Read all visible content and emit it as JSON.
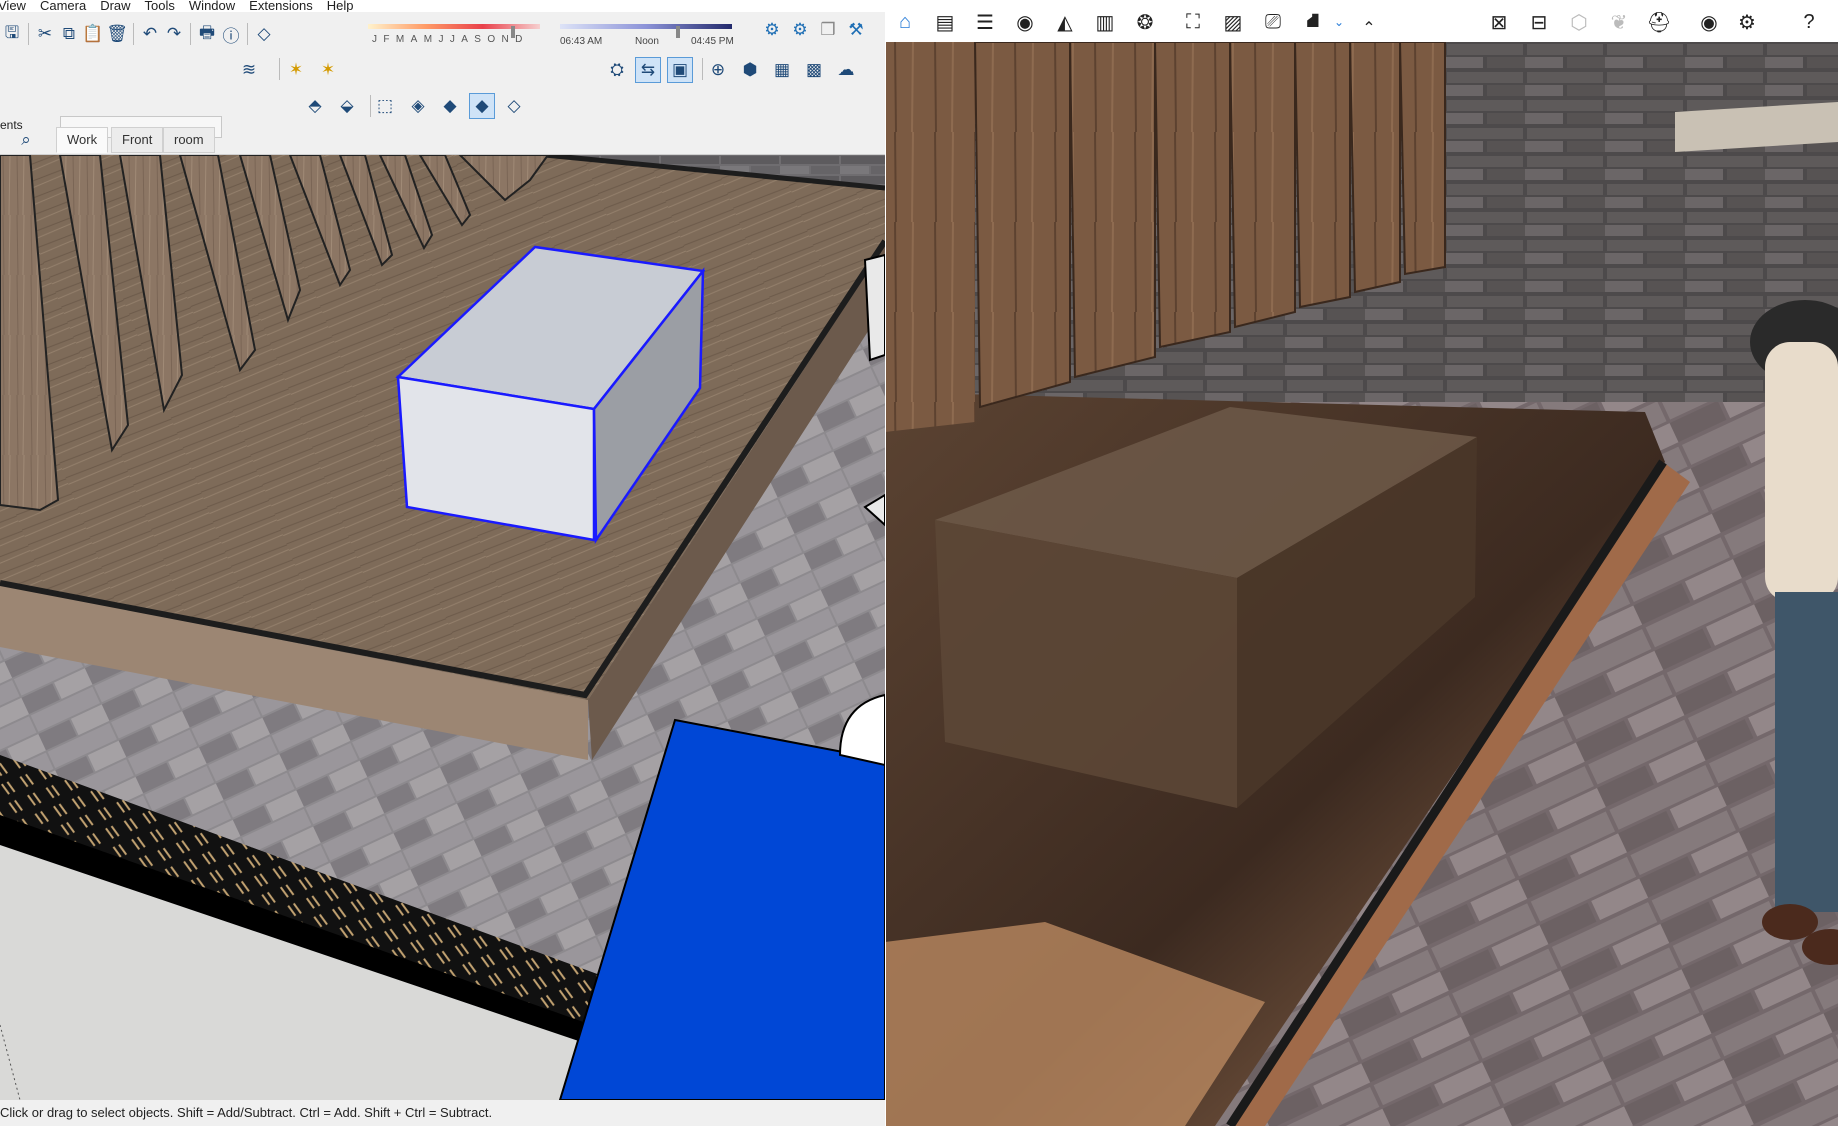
{
  "menu": [
    "View",
    "Camera",
    "Draw",
    "Tools",
    "Window",
    "Extensions",
    "Help"
  ],
  "shadow": {
    "months": "JFMAMJJASOND",
    "sunrise": "06:43 AM",
    "noon": "Noon",
    "sunset": "04:45 PM"
  },
  "layer": {
    "label": "ents",
    "value": ""
  },
  "scene_tabs": [
    "Work",
    "Front",
    "room"
  ],
  "status": "Click or drag to select objects. Shift = Add/Subtract. Ctrl = Add. Shift + Ctrl = Subtract.",
  "colors": {
    "selection": "#1a1aff",
    "blue_panel": "#0047d6",
    "enscape_home": "#2a7dd8",
    "wood": "#8a7460"
  }
}
